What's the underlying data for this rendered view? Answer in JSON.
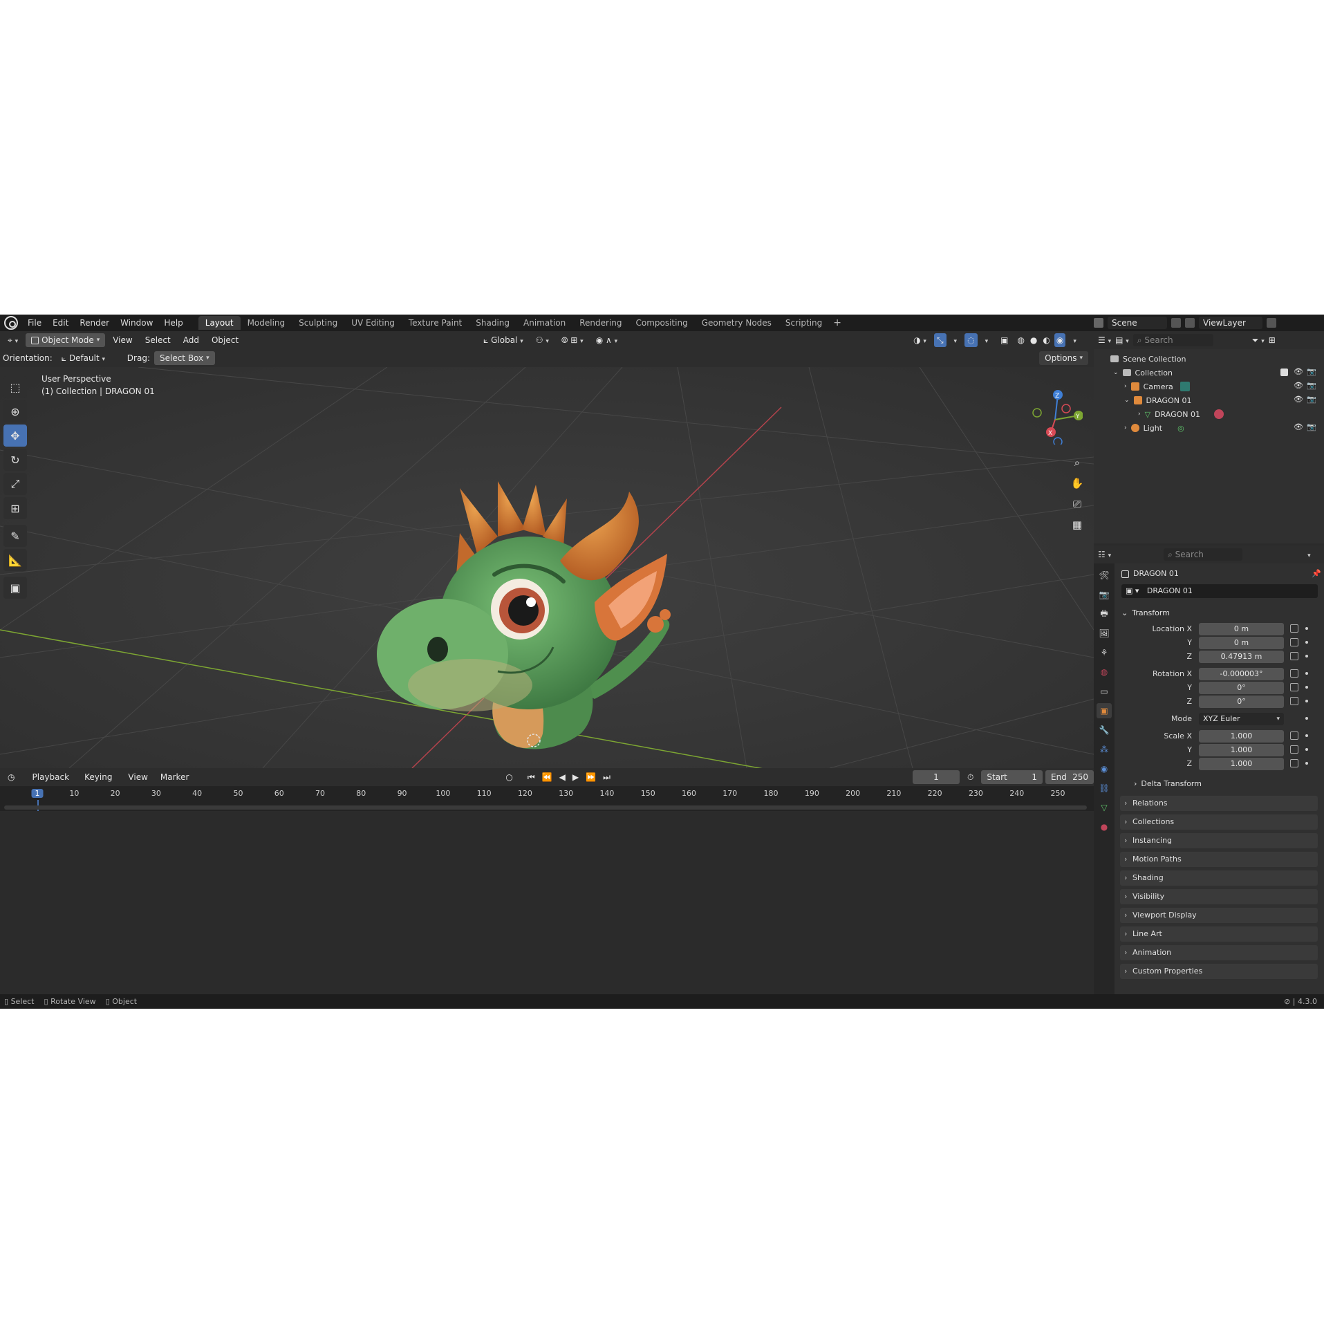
{
  "topbar": {
    "menus": [
      "File",
      "Edit",
      "Render",
      "Window",
      "Help"
    ],
    "workspaces": [
      "Layout",
      "Modeling",
      "Sculpting",
      "UV Editing",
      "Texture Paint",
      "Shading",
      "Animation",
      "Rendering",
      "Compositing",
      "Geometry Nodes",
      "Scripting"
    ],
    "active_workspace": "Layout",
    "scene_label": "Scene",
    "viewlayer_label": "ViewLayer"
  },
  "viewport_header": {
    "mode": "Object Mode",
    "menus": [
      "View",
      "Select",
      "Add",
      "Object"
    ],
    "transform_space": "Global"
  },
  "tool_settings": {
    "orientation_label": "Orientation:",
    "orientation_value": "Default",
    "drag_label": "Drag:",
    "drag_value": "Select Box",
    "options_label": "Options"
  },
  "viewport": {
    "perspective": "User Perspective",
    "collection_info": "(1) Collection | DRAGON 01",
    "gizmo_axes": {
      "z": "Z",
      "y": "Y",
      "x": "X"
    },
    "colors": {
      "bg": "#3d3d3d",
      "x_axis": "#b3434c",
      "y_axis": "#7da632",
      "dragon_green": "#5ea35c",
      "dragon_orange": "#d8753a"
    }
  },
  "timeline": {
    "menus": [
      "Playback",
      "Keying",
      "View",
      "Marker"
    ],
    "current_frame": "1",
    "start_label": "Start",
    "start_value": "1",
    "end_label": "End",
    "end_value": "250",
    "ruler": [
      "1",
      "10",
      "20",
      "30",
      "40",
      "50",
      "60",
      "70",
      "80",
      "90",
      "100",
      "110",
      "120",
      "130",
      "140",
      "150",
      "160",
      "170",
      "180",
      "190",
      "200",
      "210",
      "220",
      "230",
      "240",
      "250"
    ]
  },
  "outliner": {
    "search_placeholder": "Search",
    "items": [
      {
        "label": "Scene Collection"
      },
      {
        "label": "Collection"
      },
      {
        "label": "Camera"
      },
      {
        "label": "DRAGON 01"
      },
      {
        "label": "DRAGON 01"
      },
      {
        "label": "Light"
      }
    ]
  },
  "properties": {
    "search_placeholder": "Search",
    "object_name": "DRAGON 01",
    "object_field": "DRAGON 01",
    "transform_title": "Transform",
    "location": {
      "label": "Location X",
      "x": "0 m",
      "y": "0 m",
      "z": "0.47913 m"
    },
    "rotation": {
      "label": "Rotation X",
      "x": "-0.000003°",
      "y": "0°",
      "z": "0°"
    },
    "mode_label": "Mode",
    "mode_value": "XYZ Euler",
    "scale": {
      "label": "Scale X",
      "x": "1.000",
      "y": "1.000",
      "z": "1.000"
    },
    "axis_y": "Y",
    "axis_z": "Z",
    "delta_transform": "Delta Transform",
    "panels": [
      "Relations",
      "Collections",
      "Instancing",
      "Motion Paths",
      "Shading",
      "Visibility",
      "Viewport Display",
      "Line Art",
      "Animation",
      "Custom Properties"
    ]
  },
  "statusbar": {
    "items": [
      "Select",
      "Rotate View",
      "Object"
    ],
    "version": "4.3.0"
  }
}
